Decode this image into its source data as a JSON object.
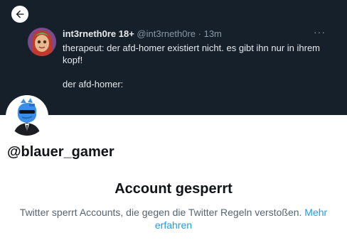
{
  "banner": {
    "background_color": "#15202b",
    "tweet": {
      "author_name": "int3rneth0re 18+",
      "author_handle": "@int3rneth0re",
      "separator": "·",
      "time": "13m",
      "more_icon": "more-horizontal-icon",
      "text": "therapeut: der afd-homer existiert nicht. es gibt ihn nur in ihrem kopf!\n\nder afd-homer:"
    }
  },
  "nav": {
    "back_icon": "arrow-left-icon"
  },
  "profile": {
    "handle": "@blauer_gamer"
  },
  "suspension": {
    "title": "Account gesperrt",
    "description": "Twitter sperrt Accounts, die gegen die Twitter Regeln verstoßen.",
    "link_label": "Mehr erfahren",
    "link_color": "#1d9bf0"
  }
}
